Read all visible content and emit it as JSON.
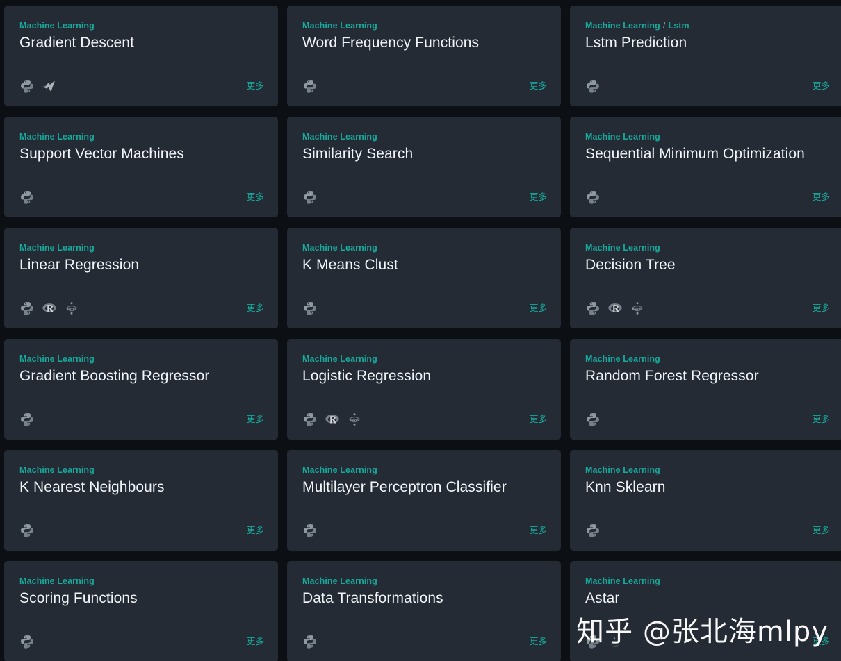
{
  "theme": {
    "page_bg": "#0c0f14",
    "card_bg": "#242b35",
    "accent": "#17a99b",
    "title_color": "#f2f5f8",
    "separator_color": "#8f9aa6"
  },
  "labels": {
    "more": "更多",
    "breadcrumb_separator": "/"
  },
  "watermark": {
    "text": "知乎 @张北海mlpy"
  },
  "cards": [
    {
      "category": "Machine Learning",
      "subcategory": null,
      "title": "Gradient Descent",
      "icons": [
        "python-icon",
        "matlab-icon"
      ],
      "more": "更多"
    },
    {
      "category": "Machine Learning",
      "subcategory": null,
      "title": "Word Frequency Functions",
      "icons": [
        "python-icon"
      ],
      "more": "更多"
    },
    {
      "category": "Machine Learning",
      "subcategory": "Lstm",
      "title": "Lstm Prediction",
      "icons": [
        "python-icon"
      ],
      "more": "更多"
    },
    {
      "category": "Machine Learning",
      "subcategory": null,
      "title": "Support Vector Machines",
      "icons": [
        "python-icon"
      ],
      "more": "更多"
    },
    {
      "category": "Machine Learning",
      "subcategory": null,
      "title": "Similarity Search",
      "icons": [
        "python-icon"
      ],
      "more": "更多"
    },
    {
      "category": "Machine Learning",
      "subcategory": null,
      "title": "Sequential Minimum Optimization",
      "icons": [
        "python-icon"
      ],
      "more": "更多"
    },
    {
      "category": "Machine Learning",
      "subcategory": null,
      "title": "Linear Regression",
      "icons": [
        "python-icon",
        "r-icon",
        "jupyter-icon"
      ],
      "more": "更多"
    },
    {
      "category": "Machine Learning",
      "subcategory": null,
      "title": "K Means Clust",
      "icons": [
        "python-icon"
      ],
      "more": "更多"
    },
    {
      "category": "Machine Learning",
      "subcategory": null,
      "title": "Decision Tree",
      "icons": [
        "python-icon",
        "r-icon",
        "jupyter-icon"
      ],
      "more": "更多"
    },
    {
      "category": "Machine Learning",
      "subcategory": null,
      "title": "Gradient Boosting Regressor",
      "icons": [
        "python-icon"
      ],
      "more": "更多"
    },
    {
      "category": "Machine Learning",
      "subcategory": null,
      "title": "Logistic Regression",
      "icons": [
        "python-icon",
        "r-icon",
        "jupyter-icon"
      ],
      "more": "更多"
    },
    {
      "category": "Machine Learning",
      "subcategory": null,
      "title": "Random Forest Regressor",
      "icons": [
        "python-icon"
      ],
      "more": "更多"
    },
    {
      "category": "Machine Learning",
      "subcategory": null,
      "title": "K Nearest Neighbours",
      "icons": [
        "python-icon"
      ],
      "more": "更多"
    },
    {
      "category": "Machine Learning",
      "subcategory": null,
      "title": "Multilayer Perceptron Classifier",
      "icons": [
        "python-icon"
      ],
      "more": "更多"
    },
    {
      "category": "Machine Learning",
      "subcategory": null,
      "title": "Knn Sklearn",
      "icons": [
        "python-icon"
      ],
      "more": "更多"
    },
    {
      "category": "Machine Learning",
      "subcategory": null,
      "title": "Scoring Functions",
      "icons": [
        "python-icon"
      ],
      "more": "更多"
    },
    {
      "category": "Machine Learning",
      "subcategory": null,
      "title": "Data Transformations",
      "icons": [
        "python-icon"
      ],
      "more": "更多"
    },
    {
      "category": "Machine Learning",
      "subcategory": null,
      "title": "Astar",
      "icons": [
        "python-icon",
        "java-icon"
      ],
      "more": "更多"
    }
  ]
}
